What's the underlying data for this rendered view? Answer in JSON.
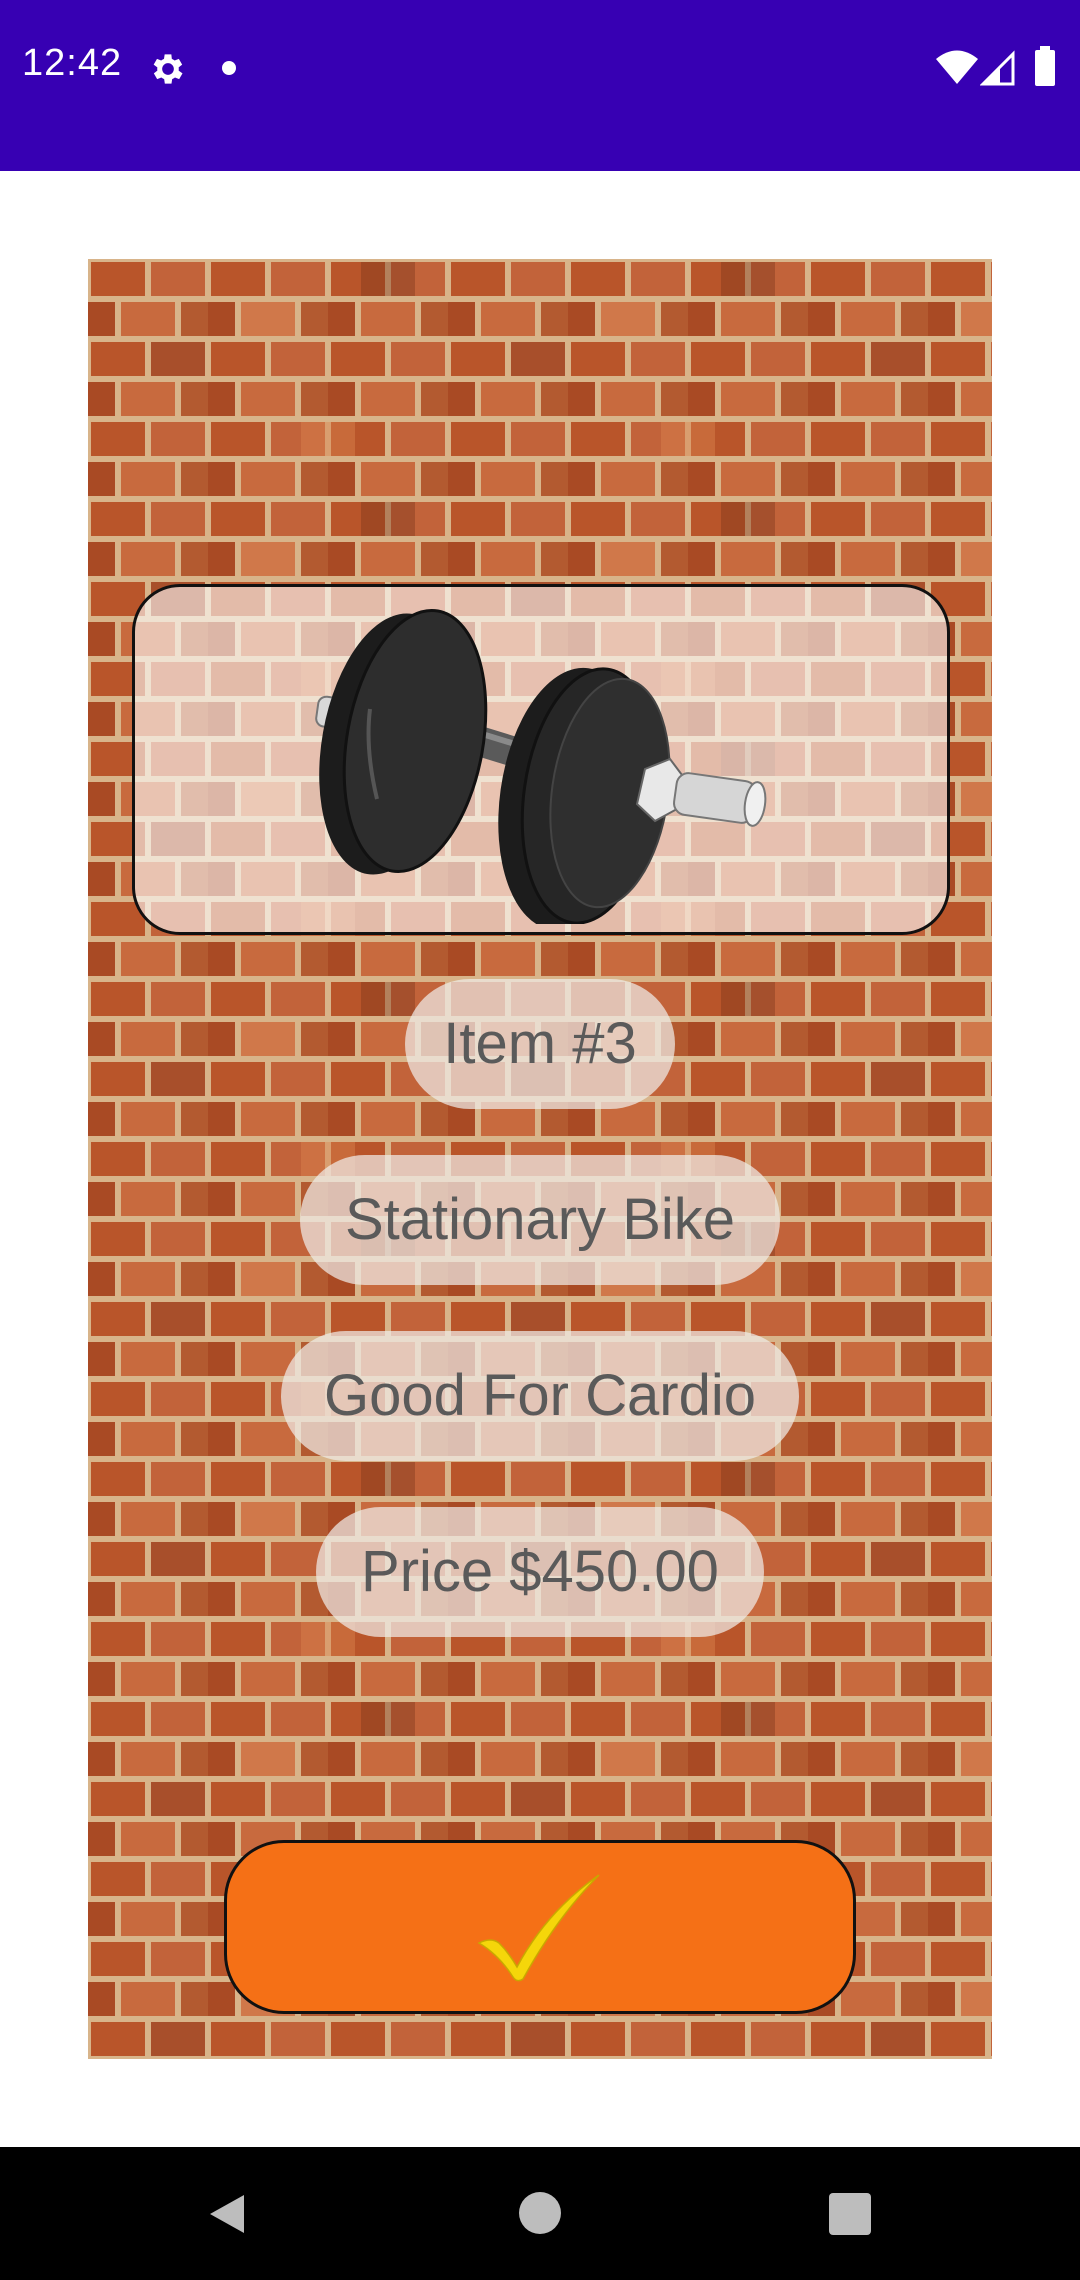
{
  "status_bar": {
    "time": "12:42",
    "icons": [
      "gear-icon",
      "notification-dot-icon",
      "wifi-icon",
      "cellular-signal-icon",
      "battery-icon"
    ],
    "background": "#3700b3"
  },
  "product": {
    "image_icon": "dumbbell-icon",
    "item_number": "Item #3",
    "name": "Stationary Bike",
    "description": "Good For Cardio",
    "price": "Price $450.00"
  },
  "confirm_button": {
    "icon": "checkmark-icon",
    "color": "#f57016"
  },
  "nav_bar": {
    "buttons": [
      "back-icon",
      "home-icon",
      "recents-icon"
    ]
  },
  "colors": {
    "brick": "#b8582f",
    "mortar": "#d8b48a",
    "check": "#f5d60a"
  }
}
